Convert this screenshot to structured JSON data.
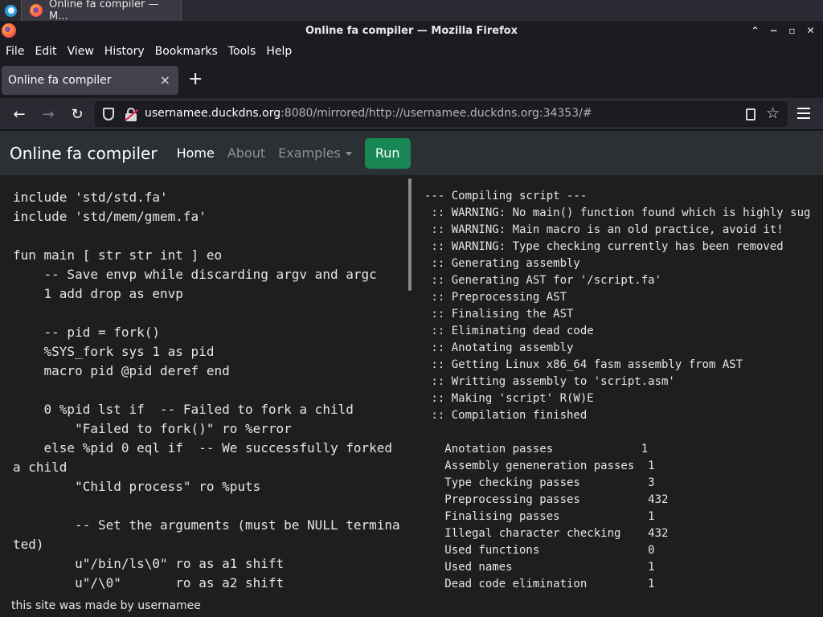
{
  "taskbar": {
    "task_title": "Online fa compiler — M..."
  },
  "window": {
    "title": "Online fa compiler — Mozilla Firefox",
    "controls": {
      "collapse": "⌃",
      "minimize": "−",
      "maximize": "▫",
      "close": "✕"
    }
  },
  "menubar": {
    "items": [
      "File",
      "Edit",
      "View",
      "History",
      "Bookmarks",
      "Tools",
      "Help"
    ]
  },
  "tabs": {
    "active_label": "Online fa compiler",
    "close_glyph": "×",
    "new_tab_glyph": "+"
  },
  "navbar": {
    "back_glyph": "←",
    "forward_glyph": "→",
    "reload_glyph": "↻",
    "url_host": "usernamee.duckdns.org",
    "url_rest": ":8080/mirrored/http://usernamee.duckdns.org:34353/#",
    "star_glyph": "☆"
  },
  "site": {
    "brand": "Online fa compiler",
    "links": [
      "Home",
      "About",
      "Examples"
    ],
    "run_label": "Run",
    "footer": "this site was made by usernamee"
  },
  "editor": {
    "code": "include 'std/std.fa'\ninclude 'std/mem/gmem.fa'\n\nfun main [ str str int ] eo\n    -- Save envp while discarding argv and argc\n    1 add drop as envp\n\n    -- pid = fork()\n    %SYS_fork sys 1 as pid\n    macro pid @pid deref end\n\n    0 %pid lst if  -- Failed to fork a child\n        \"Failed to fork()\" ro %error\n    else %pid 0 eql if  -- We successfully forked a child\n        \"Child process\" ro %puts\n\n        -- Set the arguments (must be NULL terminated)\n        u\"/bin/ls\\0\" ro as a1 shift\n        u\"/\\0\"       ro as a2 shift"
  },
  "output": {
    "text": "--- Compiling script ---\n :: WARNING: No main() function found which is highly sug\n :: WARNING: Main macro is an old practice, avoid it!\n :: WARNING: Type checking currently has been removed\n :: Generating assembly\n :: Generating AST for '/script.fa'\n :: Preprocessing AST\n :: Finalising the AST\n :: Eliminating dead code\n :: Anotating assembly\n :: Getting Linux x86_64 fasm assembly from AST\n :: Writting assembly to 'script.asm'\n :: Making 'script' R(W)E\n :: Compilation finished\n\n   Anotation passes             1\n   Assembly geneneration passes  1\n   Type checking passes          3\n   Preprocessing passes          432\n   Finalising passes             1\n   Illegal character checking    432\n   Used functions                0\n   Used names                    1\n   Dead code elimination         1"
  }
}
